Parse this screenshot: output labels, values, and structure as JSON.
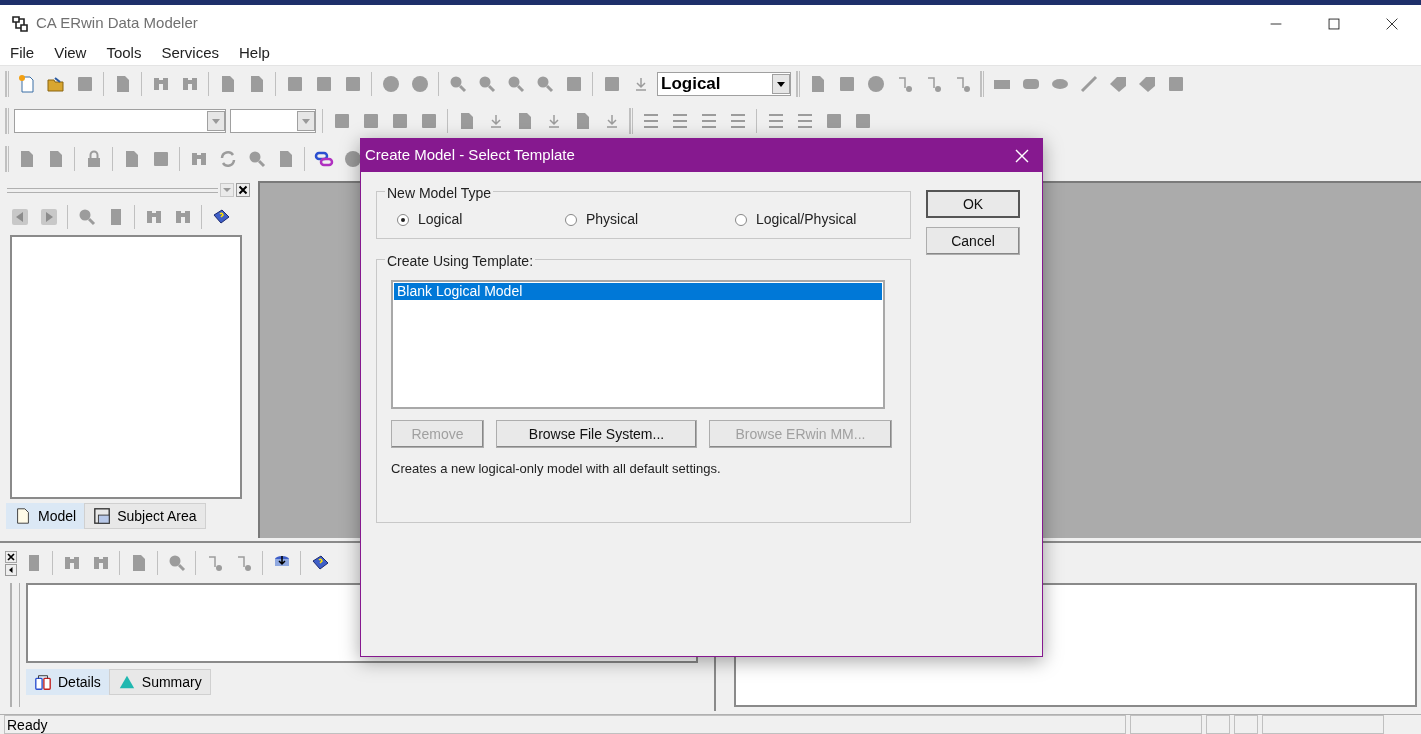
{
  "window": {
    "title": "CA ERwin Data Modeler"
  },
  "menu": [
    "File",
    "View",
    "Tools",
    "Services",
    "Help"
  ],
  "toolbar": {
    "view_dropdown": "Logical"
  },
  "model_explorer": {
    "tabs": [
      {
        "label": "Model",
        "selected": true
      },
      {
        "label": "Subject Area",
        "selected": false
      }
    ]
  },
  "details_pane": {
    "tabs": [
      {
        "label": "Details",
        "selected": true
      },
      {
        "label": "Summary",
        "selected": false
      }
    ]
  },
  "status_bar": {
    "text": "Ready"
  },
  "dialog": {
    "title": "Create Model - Select Template",
    "model_type": {
      "label": "New Model Type",
      "options": [
        {
          "label": "Logical",
          "selected": true
        },
        {
          "label": "Physical",
          "selected": false
        },
        {
          "label": "Logical/Physical",
          "selected": false
        }
      ]
    },
    "template": {
      "label": "Create Using Template:",
      "items": [
        {
          "label": "Blank Logical Model",
          "selected": true
        }
      ],
      "buttons": [
        {
          "label": "Remove",
          "disabled": true
        },
        {
          "label": "Browse File System...",
          "disabled": false
        },
        {
          "label": "Browse ERwin MM...",
          "disabled": true
        }
      ],
      "description": "Creates a new logical-only model with all default settings."
    },
    "buttons": [
      {
        "label": "OK",
        "default": true
      },
      {
        "label": "Cancel",
        "default": false
      }
    ]
  }
}
